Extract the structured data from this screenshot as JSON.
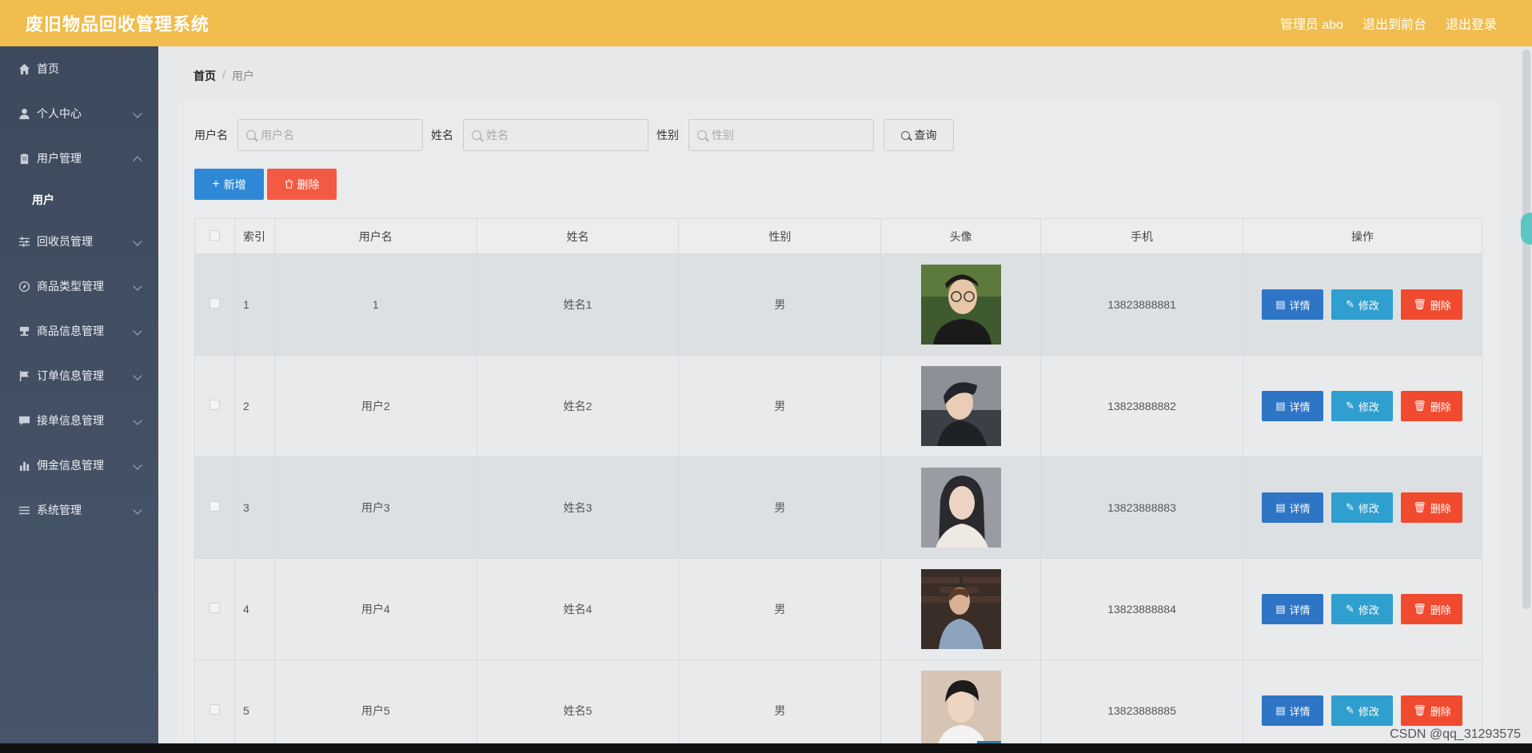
{
  "header": {
    "title": "废旧物品回收管理系统",
    "admin_label": "管理员 abo",
    "back_to_front": "退出到前台",
    "logout": "退出登录"
  },
  "sidebar": {
    "items": [
      {
        "label": "首页",
        "icon": "home-icon",
        "arrow": "none"
      },
      {
        "label": "个人中心",
        "icon": "user-icon",
        "arrow": "down"
      },
      {
        "label": "用户管理",
        "icon": "clipboard-icon",
        "arrow": "up"
      },
      {
        "label": "回收员管理",
        "icon": "sliders-icon",
        "arrow": "down"
      },
      {
        "label": "商品类型管理",
        "icon": "compass-icon",
        "arrow": "down"
      },
      {
        "label": "商品信息管理",
        "icon": "stamp-icon",
        "arrow": "down"
      },
      {
        "label": "订单信息管理",
        "icon": "flag-icon",
        "arrow": "down"
      },
      {
        "label": "接单信息管理",
        "icon": "message-icon",
        "arrow": "down"
      },
      {
        "label": "佣金信息管理",
        "icon": "bar-chart-icon",
        "arrow": "down"
      },
      {
        "label": "系统管理",
        "icon": "list-icon",
        "arrow": "down"
      }
    ],
    "sub_item": "用户"
  },
  "breadcrumb": {
    "home": "首页",
    "sep": "/",
    "current": "用户"
  },
  "search": {
    "username_label": "用户名",
    "username_placeholder": "用户名",
    "username_value": "",
    "name_label": "姓名",
    "name_placeholder": "姓名",
    "name_value": "",
    "gender_label": "性别",
    "gender_placeholder": "性别",
    "gender_value": "",
    "query_button": "查询"
  },
  "actions": {
    "add": "新增",
    "delete": "删除"
  },
  "table": {
    "headers": [
      "索引",
      "用户名",
      "姓名",
      "性别",
      "头像",
      "手机",
      "操作"
    ],
    "op_labels": {
      "detail": "详情",
      "edit": "修改",
      "delete": "删除"
    },
    "rows": [
      {
        "index": "1",
        "username": "1",
        "name": "姓名1",
        "gender": "男",
        "phone": "13823888881"
      },
      {
        "index": "2",
        "username": "用户2",
        "name": "姓名2",
        "gender": "男",
        "phone": "13823888882"
      },
      {
        "index": "3",
        "username": "用户3",
        "name": "姓名3",
        "gender": "男",
        "phone": "13823888883"
      },
      {
        "index": "4",
        "username": "用户4",
        "name": "姓名4",
        "gender": "男",
        "phone": "13823888884"
      },
      {
        "index": "5",
        "username": "用户5",
        "name": "姓名5",
        "gender": "男",
        "phone": "13823888885"
      }
    ]
  },
  "watermark": "CSDN @qq_31293575",
  "colors": {
    "header": "#f0bd4e",
    "sidebar": "#3d4a5d",
    "primary": "#2e88d6",
    "danger": "#f35a43",
    "edit": "#2f9fcf"
  }
}
